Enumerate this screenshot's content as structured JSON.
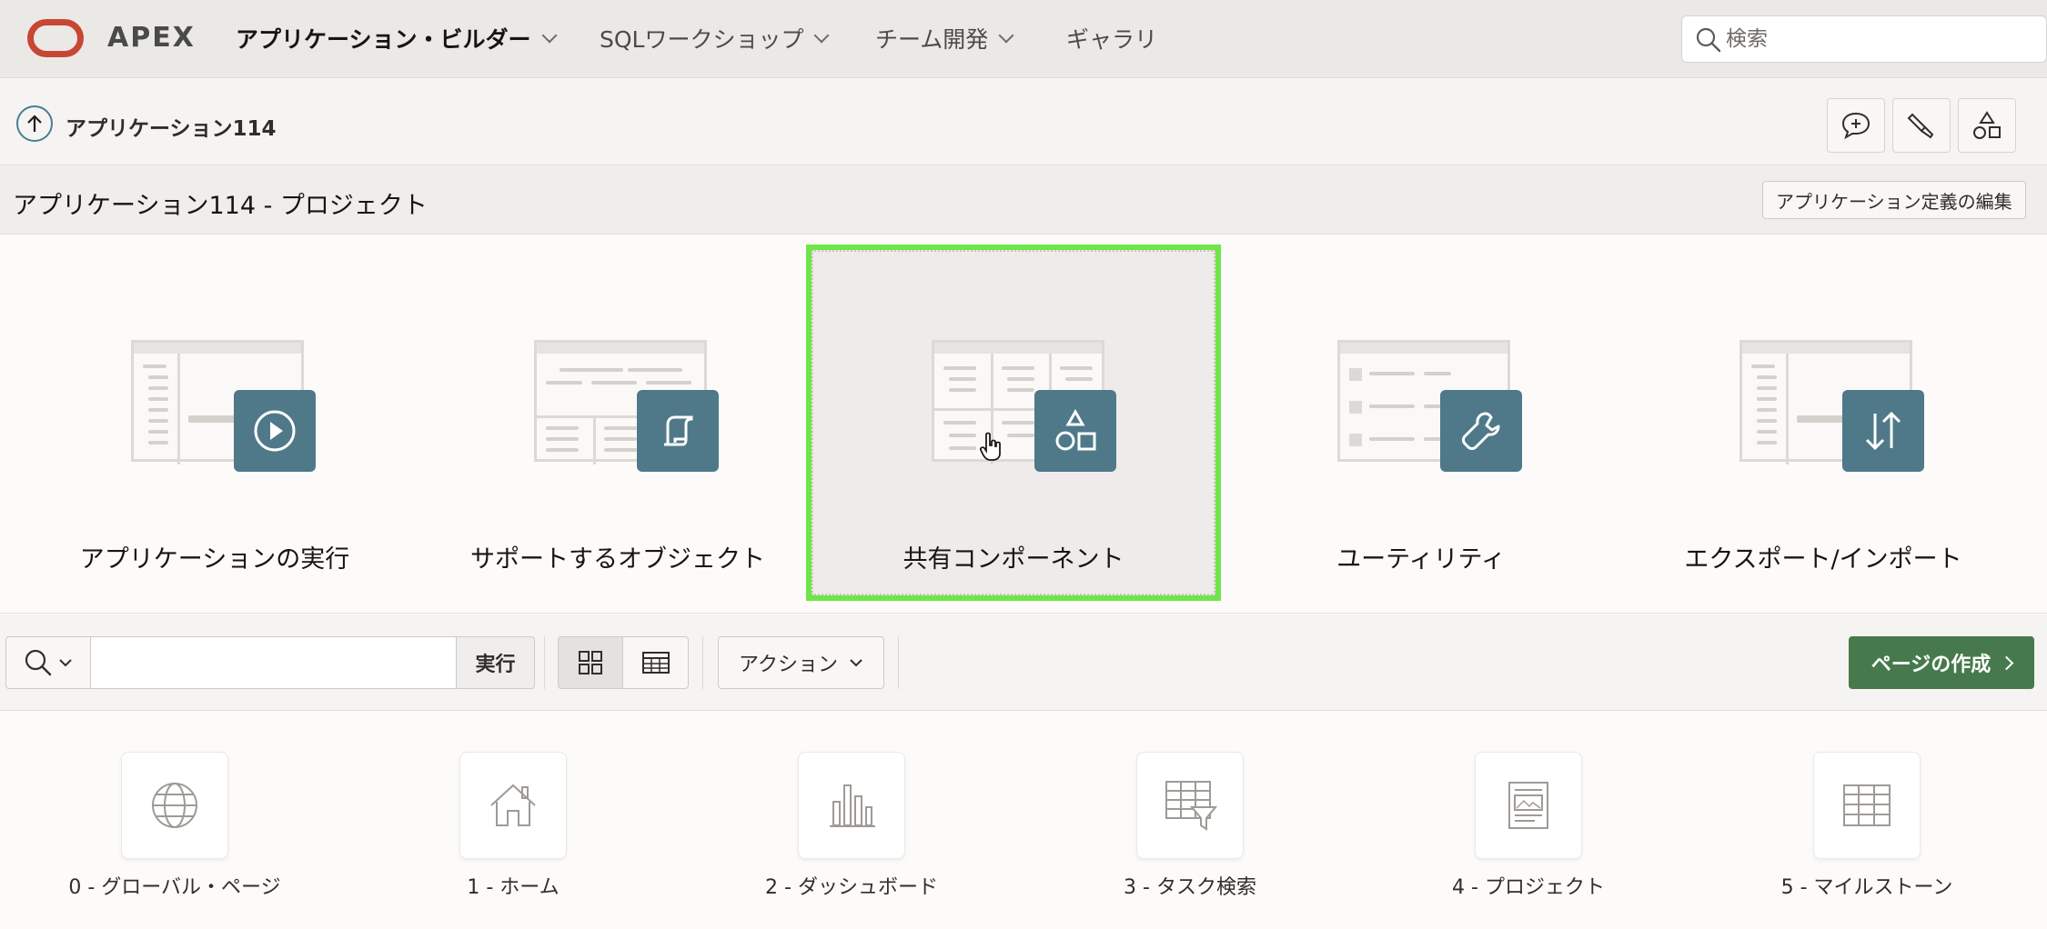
{
  "brand": {
    "name": "APEX",
    "logo_color": "#c74634"
  },
  "nav": {
    "items": [
      {
        "label": "アプリケーション・ビルダー",
        "active": true,
        "has_menu": true
      },
      {
        "label": "SQLワークショップ",
        "active": false,
        "has_menu": true
      },
      {
        "label": "チーム開発",
        "active": false,
        "has_menu": true
      },
      {
        "label": "ギャラリ",
        "active": false,
        "has_menu": false
      }
    ],
    "search_placeholder": "検索"
  },
  "breadcrumb": {
    "title": "アプリケーション114",
    "tools": [
      "comment-add-icon",
      "brush-icon",
      "shared-components-icon"
    ]
  },
  "region": {
    "title": "アプリケーション114 - プロジェクト",
    "edit_definition_label": "アプリケーション定義の編集"
  },
  "hero_cards": [
    {
      "label": "アプリケーションの実行",
      "icon": "play-icon",
      "selected": false
    },
    {
      "label": "サポートするオブジェクト",
      "icon": "scroll-icon",
      "selected": false
    },
    {
      "label": "共有コンポーネント",
      "icon": "shapes-icon",
      "selected": true
    },
    {
      "label": "ユーティリティ",
      "icon": "wrench-icon",
      "selected": false
    },
    {
      "label": "エクスポート/インポート",
      "icon": "arrows-updown-icon",
      "selected": false
    }
  ],
  "toolbar": {
    "search_value": "",
    "go_label": "実行",
    "actions_label": "アクション",
    "create_page_label": "ページの作成",
    "view_mode": "grid"
  },
  "pages": [
    {
      "label": "0 - グローバル・ページ",
      "icon": "globe-icon"
    },
    {
      "label": "1 - ホーム",
      "icon": "home-icon"
    },
    {
      "label": "2 - ダッシュボード",
      "icon": "bar-chart-icon"
    },
    {
      "label": "3 - タスク検索",
      "icon": "table-filter-icon"
    },
    {
      "label": "4 - プロジェクト",
      "icon": "form-icon"
    },
    {
      "label": "5 - マイルストーン",
      "icon": "grid-table-icon"
    }
  ],
  "colors": {
    "accent_badge": "#4f7989",
    "primary_button": "#467a4c",
    "selection_outline": "#6ee549"
  }
}
